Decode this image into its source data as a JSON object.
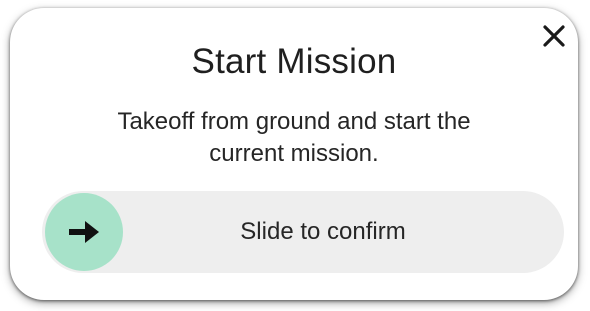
{
  "dialog": {
    "title": "Start Mission",
    "message_line1": "Takeoff from ground and start the",
    "message_line2": "current mission.",
    "close_icon": "close-icon"
  },
  "slider": {
    "label": "Slide to confirm",
    "handle_icon": "arrow-right-icon",
    "handle_color": "#a7e2c9",
    "track_color": "#eeeeee",
    "progress": 0
  }
}
